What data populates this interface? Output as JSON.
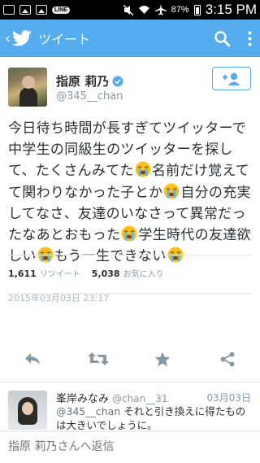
{
  "status_bar": {
    "battery_percent": "87%",
    "time": "3:15 PM",
    "line_badge": "LINE"
  },
  "header": {
    "back_symbol": "‹",
    "title": "ツイート",
    "accent_color": "#55acee"
  },
  "tweet": {
    "display_name": "指原 莉乃",
    "handle": "@345__chan",
    "text_segments": [
      "今日待ち時間が長すぎてツイッターで中学生の同級生のツイッターを探して、たくさんみてた",
      "名前だけ覚えてて関わりなかった子とか",
      "自分の充実してなさ、友達のいなさって異常だったなあとおもった",
      "学生時代の友達欲しい",
      "もう一生できない",
      ""
    ],
    "date": "2015年03月03日 23:17",
    "retweet_count": "1,611",
    "retweet_label": "リツイート",
    "favorite_count": "5,038",
    "favorite_label": "お気に入り"
  },
  "reply": {
    "name": "峯岸みなみ",
    "handle": "@chan__31",
    "date": "03月03日",
    "mention": "@345__chan",
    "text": " それと引き換えに得たものは大きいでしょうに。"
  },
  "compose": {
    "placeholder": "指原 莉乃さんへ返信"
  },
  "icons": [
    "back-icon",
    "twitter-bird-icon",
    "search-icon",
    "overflow-menu-icon",
    "verified-icon",
    "follow-icon",
    "reply-icon",
    "retweet-icon",
    "favorite-icon",
    "share-icon",
    "crying-face-emoji"
  ]
}
